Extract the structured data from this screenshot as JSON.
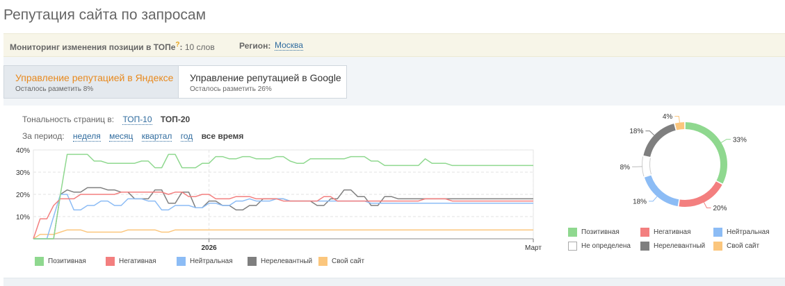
{
  "page_title": "Репутация сайта по запросам",
  "monitoring": {
    "label": "Мониторинг изменения позиции в ТОПе",
    "help_mark": "?",
    "colon": ":",
    "count": "10 слов",
    "region_label": "Регион:",
    "region_value": "Москва"
  },
  "tabs": [
    {
      "title": "Управление репутацией в Яндексе",
      "subtitle": "Осталось разметить 8%",
      "active": true
    },
    {
      "title": "Управление репутацией в Google",
      "subtitle": "Осталось разметить 26%",
      "active": false
    }
  ],
  "filters": {
    "tonality_label": "Тональность страниц в:",
    "tonality_options": [
      "ТОП-10",
      "ТОП-20"
    ],
    "tonality_selected": "ТОП-20",
    "period_label": "За период:",
    "period_options": [
      "неделя",
      "месяц",
      "квартал",
      "год",
      "все время"
    ],
    "period_selected": "все время"
  },
  "colors": {
    "positive": "#8fd88f",
    "negative": "#f37f7f",
    "neutral": "#8cbcf5",
    "undefined": "#ffffff",
    "irrelevant": "#7f7f7f",
    "own_site": "#fbc67d",
    "link": "#2f6b9e",
    "accent": "#e8891d"
  },
  "chart_data": [
    {
      "type": "line",
      "x_labels": [
        {
          "i": 26,
          "label": "2026"
        },
        {
          "i": 74,
          "label": "Март"
        }
      ],
      "ylim": [
        0,
        40
      ],
      "yticks": [
        "10%",
        "20%",
        "30%",
        "40%"
      ],
      "grid": true,
      "legend_position": "bottom-left",
      "series": [
        {
          "name": "Позитивная",
          "color": "#8fd88f",
          "values": [
            0,
            0,
            0,
            0,
            20,
            38,
            38,
            38,
            38,
            35,
            35,
            34,
            34,
            34,
            34,
            34,
            35,
            35,
            32,
            32,
            38,
            38,
            32,
            32,
            32,
            34,
            34,
            37,
            37,
            36,
            36,
            37,
            37,
            36,
            36,
            36,
            37,
            37,
            35,
            34,
            34,
            36,
            36,
            36,
            36,
            36,
            36,
            37,
            37,
            37,
            35,
            35,
            33,
            33,
            33,
            33,
            33,
            33,
            36,
            34,
            34,
            34,
            33,
            33,
            33,
            33,
            33,
            33,
            33,
            33,
            33,
            33,
            33,
            33,
            33
          ]
        },
        {
          "name": "Негативная",
          "color": "#f37f7f",
          "values": [
            0,
            9,
            9,
            15,
            18,
            18,
            18,
            20,
            20,
            20,
            20,
            20,
            20,
            21,
            21,
            21,
            21,
            21,
            21,
            21,
            20,
            21,
            21,
            19,
            19,
            20,
            20,
            18,
            18,
            18,
            19,
            19,
            19,
            18,
            18,
            18,
            18,
            17,
            17,
            17,
            17,
            17,
            17,
            19,
            19,
            17,
            17,
            17,
            17,
            17,
            17,
            17,
            17,
            17,
            17,
            17,
            17,
            17,
            18,
            18,
            18,
            18,
            17,
            17,
            17,
            17,
            17,
            17,
            17,
            17,
            17,
            17,
            17,
            17,
            17
          ]
        },
        {
          "name": "Нейтральная",
          "color": "#8cbcf5",
          "values": [
            0,
            0,
            0,
            10,
            20,
            20,
            13,
            13,
            15,
            15,
            17,
            17,
            15,
            15,
            18,
            18,
            18,
            17,
            17,
            13,
            13,
            15,
            15,
            15,
            14,
            14,
            16,
            16,
            15,
            15,
            17,
            17,
            18,
            17,
            17,
            17,
            18,
            18,
            17,
            17,
            17,
            17,
            17,
            17,
            17,
            17,
            17,
            17,
            17,
            17,
            16,
            16,
            16,
            16,
            16,
            16,
            16,
            16,
            16,
            16,
            16,
            16,
            16,
            16,
            16,
            16,
            16,
            16,
            16,
            16,
            16,
            16,
            16,
            16,
            16
          ]
        },
        {
          "name": "Нерелевантный",
          "color": "#7f7f7f",
          "values": [
            0,
            0,
            0,
            0,
            20,
            22,
            21,
            21,
            23,
            23,
            23,
            22,
            22,
            21,
            21,
            18,
            18,
            18,
            22,
            22,
            16,
            16,
            21,
            21,
            14,
            14,
            17,
            17,
            15,
            15,
            13,
            13,
            15,
            15,
            18,
            18,
            18,
            18,
            17,
            17,
            17,
            17,
            15,
            15,
            18,
            18,
            22,
            22,
            19,
            19,
            15,
            15,
            19,
            19,
            18,
            18,
            18,
            18,
            18,
            18,
            18,
            18,
            18,
            18,
            18,
            18,
            18,
            18,
            18,
            18,
            18,
            18,
            18,
            18,
            18
          ]
        },
        {
          "name": "Свой сайт",
          "color": "#fbc67d",
          "values": [
            0,
            2,
            2,
            2,
            3,
            4,
            4,
            4,
            3,
            3,
            3,
            3,
            3,
            3,
            4,
            4,
            4,
            4,
            4,
            3,
            3,
            4,
            4,
            4,
            4,
            4,
            4,
            4,
            4,
            4,
            4,
            4,
            4,
            4,
            4,
            4,
            4,
            4,
            4,
            4,
            4,
            4,
            4,
            4,
            4,
            4,
            4,
            4,
            4,
            4,
            4,
            4,
            4,
            4,
            4,
            4,
            4,
            4,
            4,
            4,
            4,
            4,
            4,
            4,
            4,
            4,
            4,
            4,
            4,
            4,
            4,
            4,
            4,
            4,
            4
          ]
        }
      ]
    },
    {
      "type": "pie",
      "donut": true,
      "slices": [
        {
          "name": "Позитивная",
          "value": 33,
          "label": "33%",
          "color": "#8fd88f"
        },
        {
          "name": "Негативная",
          "value": 20,
          "label": "20%",
          "color": "#f37f7f"
        },
        {
          "name": "Нейтральная",
          "value": 18,
          "label": "18%",
          "color": "#8cbcf5"
        },
        {
          "name": "Не определена",
          "value": 8,
          "label": "8%",
          "color": "#ffffff"
        },
        {
          "name": "Нерелевантный",
          "value": 18,
          "label": "18%",
          "color": "#7f7f7f"
        },
        {
          "name": "Свой сайт",
          "value": 4,
          "label": "4%",
          "color": "#fbc67d"
        }
      ],
      "legend_position": "bottom"
    }
  ],
  "line_legend": [
    "Позитивная",
    "Негативная",
    "Нейтральная",
    "Нерелевантный",
    "Свой сайт"
  ],
  "pie_legend": [
    "Позитивная",
    "Негативная",
    "Нейтральная",
    "Не определена",
    "Нерелевантный",
    "Свой сайт"
  ]
}
